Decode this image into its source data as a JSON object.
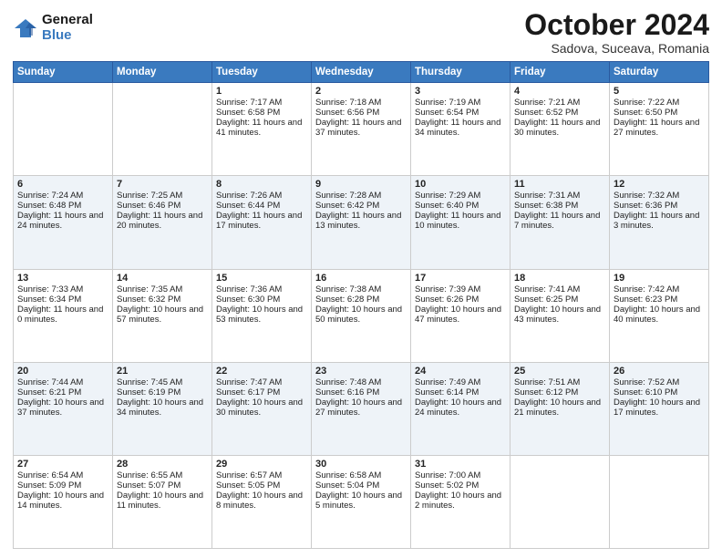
{
  "header": {
    "logo_general": "General",
    "logo_blue": "Blue",
    "month": "October 2024",
    "location": "Sadova, Suceava, Romania"
  },
  "days_of_week": [
    "Sunday",
    "Monday",
    "Tuesday",
    "Wednesday",
    "Thursday",
    "Friday",
    "Saturday"
  ],
  "weeks": [
    [
      {
        "day": "",
        "sunrise": "",
        "sunset": "",
        "daylight": ""
      },
      {
        "day": "",
        "sunrise": "",
        "sunset": "",
        "daylight": ""
      },
      {
        "day": "1",
        "sunrise": "Sunrise: 7:17 AM",
        "sunset": "Sunset: 6:58 PM",
        "daylight": "Daylight: 11 hours and 41 minutes."
      },
      {
        "day": "2",
        "sunrise": "Sunrise: 7:18 AM",
        "sunset": "Sunset: 6:56 PM",
        "daylight": "Daylight: 11 hours and 37 minutes."
      },
      {
        "day": "3",
        "sunrise": "Sunrise: 7:19 AM",
        "sunset": "Sunset: 6:54 PM",
        "daylight": "Daylight: 11 hours and 34 minutes."
      },
      {
        "day": "4",
        "sunrise": "Sunrise: 7:21 AM",
        "sunset": "Sunset: 6:52 PM",
        "daylight": "Daylight: 11 hours and 30 minutes."
      },
      {
        "day": "5",
        "sunrise": "Sunrise: 7:22 AM",
        "sunset": "Sunset: 6:50 PM",
        "daylight": "Daylight: 11 hours and 27 minutes."
      }
    ],
    [
      {
        "day": "6",
        "sunrise": "Sunrise: 7:24 AM",
        "sunset": "Sunset: 6:48 PM",
        "daylight": "Daylight: 11 hours and 24 minutes."
      },
      {
        "day": "7",
        "sunrise": "Sunrise: 7:25 AM",
        "sunset": "Sunset: 6:46 PM",
        "daylight": "Daylight: 11 hours and 20 minutes."
      },
      {
        "day": "8",
        "sunrise": "Sunrise: 7:26 AM",
        "sunset": "Sunset: 6:44 PM",
        "daylight": "Daylight: 11 hours and 17 minutes."
      },
      {
        "day": "9",
        "sunrise": "Sunrise: 7:28 AM",
        "sunset": "Sunset: 6:42 PM",
        "daylight": "Daylight: 11 hours and 13 minutes."
      },
      {
        "day": "10",
        "sunrise": "Sunrise: 7:29 AM",
        "sunset": "Sunset: 6:40 PM",
        "daylight": "Daylight: 11 hours and 10 minutes."
      },
      {
        "day": "11",
        "sunrise": "Sunrise: 7:31 AM",
        "sunset": "Sunset: 6:38 PM",
        "daylight": "Daylight: 11 hours and 7 minutes."
      },
      {
        "day": "12",
        "sunrise": "Sunrise: 7:32 AM",
        "sunset": "Sunset: 6:36 PM",
        "daylight": "Daylight: 11 hours and 3 minutes."
      }
    ],
    [
      {
        "day": "13",
        "sunrise": "Sunrise: 7:33 AM",
        "sunset": "Sunset: 6:34 PM",
        "daylight": "Daylight: 11 hours and 0 minutes."
      },
      {
        "day": "14",
        "sunrise": "Sunrise: 7:35 AM",
        "sunset": "Sunset: 6:32 PM",
        "daylight": "Daylight: 10 hours and 57 minutes."
      },
      {
        "day": "15",
        "sunrise": "Sunrise: 7:36 AM",
        "sunset": "Sunset: 6:30 PM",
        "daylight": "Daylight: 10 hours and 53 minutes."
      },
      {
        "day": "16",
        "sunrise": "Sunrise: 7:38 AM",
        "sunset": "Sunset: 6:28 PM",
        "daylight": "Daylight: 10 hours and 50 minutes."
      },
      {
        "day": "17",
        "sunrise": "Sunrise: 7:39 AM",
        "sunset": "Sunset: 6:26 PM",
        "daylight": "Daylight: 10 hours and 47 minutes."
      },
      {
        "day": "18",
        "sunrise": "Sunrise: 7:41 AM",
        "sunset": "Sunset: 6:25 PM",
        "daylight": "Daylight: 10 hours and 43 minutes."
      },
      {
        "day": "19",
        "sunrise": "Sunrise: 7:42 AM",
        "sunset": "Sunset: 6:23 PM",
        "daylight": "Daylight: 10 hours and 40 minutes."
      }
    ],
    [
      {
        "day": "20",
        "sunrise": "Sunrise: 7:44 AM",
        "sunset": "Sunset: 6:21 PM",
        "daylight": "Daylight: 10 hours and 37 minutes."
      },
      {
        "day": "21",
        "sunrise": "Sunrise: 7:45 AM",
        "sunset": "Sunset: 6:19 PM",
        "daylight": "Daylight: 10 hours and 34 minutes."
      },
      {
        "day": "22",
        "sunrise": "Sunrise: 7:47 AM",
        "sunset": "Sunset: 6:17 PM",
        "daylight": "Daylight: 10 hours and 30 minutes."
      },
      {
        "day": "23",
        "sunrise": "Sunrise: 7:48 AM",
        "sunset": "Sunset: 6:16 PM",
        "daylight": "Daylight: 10 hours and 27 minutes."
      },
      {
        "day": "24",
        "sunrise": "Sunrise: 7:49 AM",
        "sunset": "Sunset: 6:14 PM",
        "daylight": "Daylight: 10 hours and 24 minutes."
      },
      {
        "day": "25",
        "sunrise": "Sunrise: 7:51 AM",
        "sunset": "Sunset: 6:12 PM",
        "daylight": "Daylight: 10 hours and 21 minutes."
      },
      {
        "day": "26",
        "sunrise": "Sunrise: 7:52 AM",
        "sunset": "Sunset: 6:10 PM",
        "daylight": "Daylight: 10 hours and 17 minutes."
      }
    ],
    [
      {
        "day": "27",
        "sunrise": "Sunrise: 6:54 AM",
        "sunset": "Sunset: 5:09 PM",
        "daylight": "Daylight: 10 hours and 14 minutes."
      },
      {
        "day": "28",
        "sunrise": "Sunrise: 6:55 AM",
        "sunset": "Sunset: 5:07 PM",
        "daylight": "Daylight: 10 hours and 11 minutes."
      },
      {
        "day": "29",
        "sunrise": "Sunrise: 6:57 AM",
        "sunset": "Sunset: 5:05 PM",
        "daylight": "Daylight: 10 hours and 8 minutes."
      },
      {
        "day": "30",
        "sunrise": "Sunrise: 6:58 AM",
        "sunset": "Sunset: 5:04 PM",
        "daylight": "Daylight: 10 hours and 5 minutes."
      },
      {
        "day": "31",
        "sunrise": "Sunrise: 7:00 AM",
        "sunset": "Sunset: 5:02 PM",
        "daylight": "Daylight: 10 hours and 2 minutes."
      },
      {
        "day": "",
        "sunrise": "",
        "sunset": "",
        "daylight": ""
      },
      {
        "day": "",
        "sunrise": "",
        "sunset": "",
        "daylight": ""
      }
    ]
  ]
}
